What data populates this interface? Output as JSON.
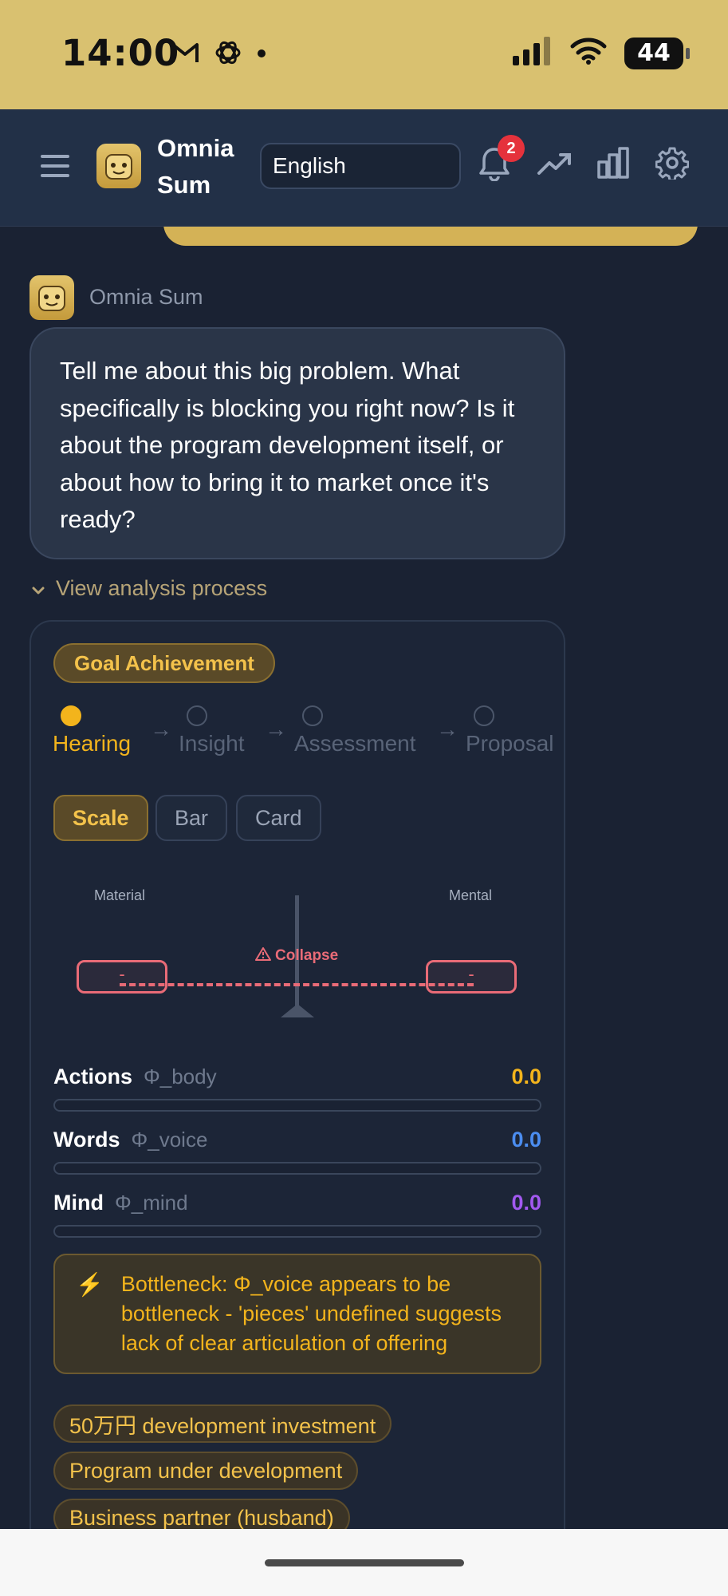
{
  "status_bar": {
    "time": "14:00",
    "battery": "44",
    "left_icons": [
      "gmail-icon",
      "openai-icon",
      "dot-icon"
    ],
    "right_icons": [
      "signal-icon",
      "wifi-icon",
      "battery-icon"
    ]
  },
  "header": {
    "app_name": "Omnia Sum",
    "language": "English",
    "notification_count": "2",
    "icons": [
      "menu-icon",
      "bell-icon",
      "trending-icon",
      "bar-chart-icon",
      "gear-icon"
    ]
  },
  "message": {
    "sender": "Omnia Sum",
    "text": "Tell me about this big problem. What specifically is blocking you right now? Is it about the program development itself, or about how to bring it to market once it's ready?"
  },
  "analysis": {
    "toggle_label": "View analysis process",
    "goal_badge": "Goal Achievement",
    "steps": [
      {
        "label": "Hearing",
        "active": true
      },
      {
        "label": "Insight",
        "active": false
      },
      {
        "label": "Assessment",
        "active": false
      },
      {
        "label": "Proposal",
        "active": false
      }
    ],
    "view_tabs": [
      "Scale",
      "Bar",
      "Card"
    ],
    "active_view": "Scale",
    "scale": {
      "left_label": "Material",
      "right_label": "Mental",
      "left_value": "-",
      "right_value": "-",
      "state": "Collapse"
    },
    "metrics": [
      {
        "name": "Actions",
        "symbol": "Φ_body",
        "value": "0.0",
        "color": "#f3b41c"
      },
      {
        "name": "Words",
        "symbol": "Φ_voice",
        "value": "0.0",
        "color": "#4b8df0"
      },
      {
        "name": "Mind",
        "symbol": "Φ_mind",
        "value": "0.0",
        "color": "#a259f0"
      }
    ],
    "bottleneck": "Bottleneck: Φ_voice appears to be bottleneck - 'pieces' undefined suggests lack of clear articulation of offering",
    "tags": [
      "50万円 development investment",
      "Program under development",
      "Business partner (husband)"
    ]
  },
  "colors": {
    "accent": "#f3b41c",
    "background": "#1a2233",
    "status_bar": "#d9c170",
    "danger": "#e96b77"
  }
}
